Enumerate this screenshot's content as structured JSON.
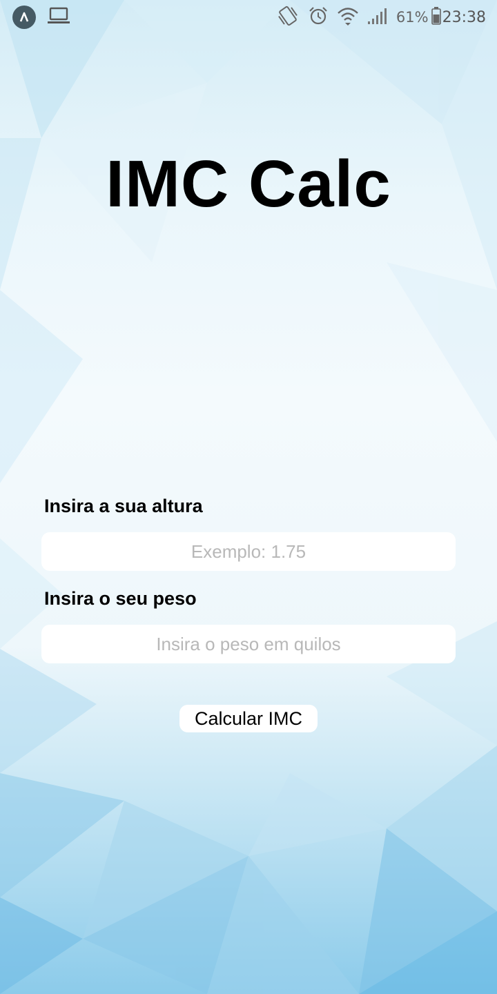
{
  "status_bar": {
    "battery_text": "61%",
    "time": "23:38",
    "icons": [
      "app-badge-icon",
      "laptop-icon",
      "vibrate-icon",
      "alarm-icon",
      "wifi-icon",
      "signal-icon",
      "battery-icon"
    ]
  },
  "title": "IMC Calc",
  "form": {
    "height_label": "Insira a sua altura",
    "height_placeholder": "Exemplo: 1.75",
    "weight_label": "Insira o seu peso",
    "weight_placeholder": "Insira o peso em quilos",
    "button_label": "Calcular IMC"
  },
  "colors": {
    "background_light": "#eaf6fb",
    "background_accent": "#5fb6e4",
    "title": "#000000",
    "input_background": "#ffffff",
    "placeholder": "#b8b8b8"
  }
}
